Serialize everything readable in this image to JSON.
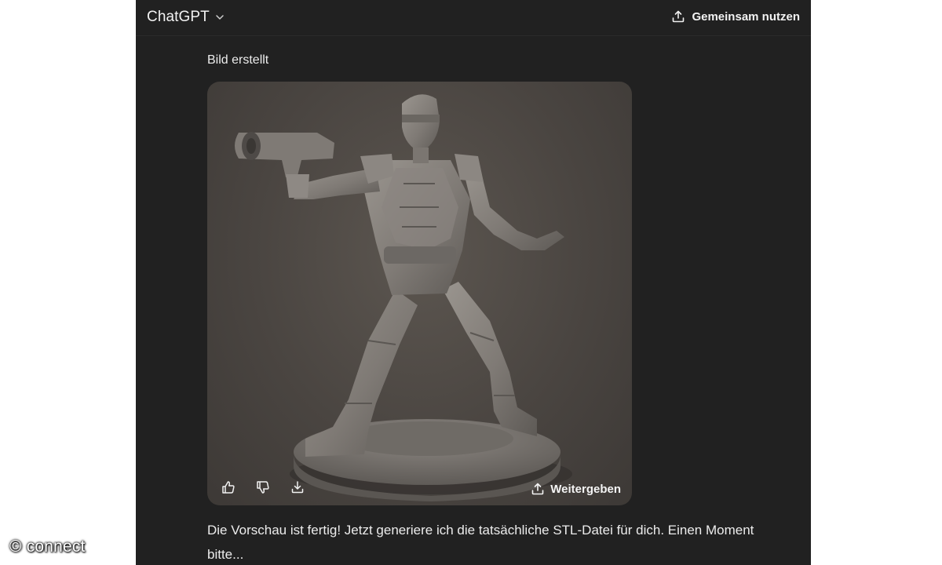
{
  "header": {
    "model_name": "ChatGPT",
    "share_label": "Gemeinsam nutzen"
  },
  "message": {
    "status_label": "Bild erstellt",
    "image": {
      "share_label": "Weitergeben",
      "actions": [
        "thumbs-up-icon",
        "thumbs-down-icon",
        "download-icon"
      ]
    },
    "text": "Die Vorschau ist fertig! Jetzt generiere ich die tatsächliche STL-Datei für dich. Einen Moment bitte..."
  },
  "watermark": "© connect",
  "colors": {
    "app_background": "#212121",
    "text": "#ececec",
    "image_background": "#4a4541",
    "figure": "#8a8580"
  }
}
